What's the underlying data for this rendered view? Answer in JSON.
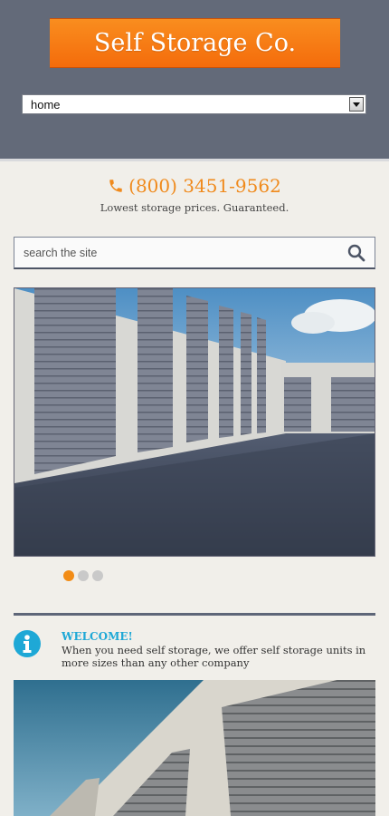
{
  "header": {
    "logo_text": "Self Storage Co.",
    "nav_select": {
      "selected": "home"
    }
  },
  "contact": {
    "phone": "(800) 3451-9562",
    "tagline": "Lowest storage prices. Guaranteed."
  },
  "search": {
    "placeholder": "search the site",
    "icon": "search-icon"
  },
  "slider": {
    "image": "storage-units-row-photo",
    "active_slide": 1,
    "slide_count": 3
  },
  "welcome": {
    "icon": "info-icon",
    "title": "WELCOME!",
    "text": "When you need self storage, we offer self storage units in more sizes than any other company"
  },
  "colors": {
    "header_bg": "#636a79",
    "accent_orange": "#f47f15",
    "accent_blue": "#1ea8d6",
    "page_bg": "#f1efea"
  }
}
